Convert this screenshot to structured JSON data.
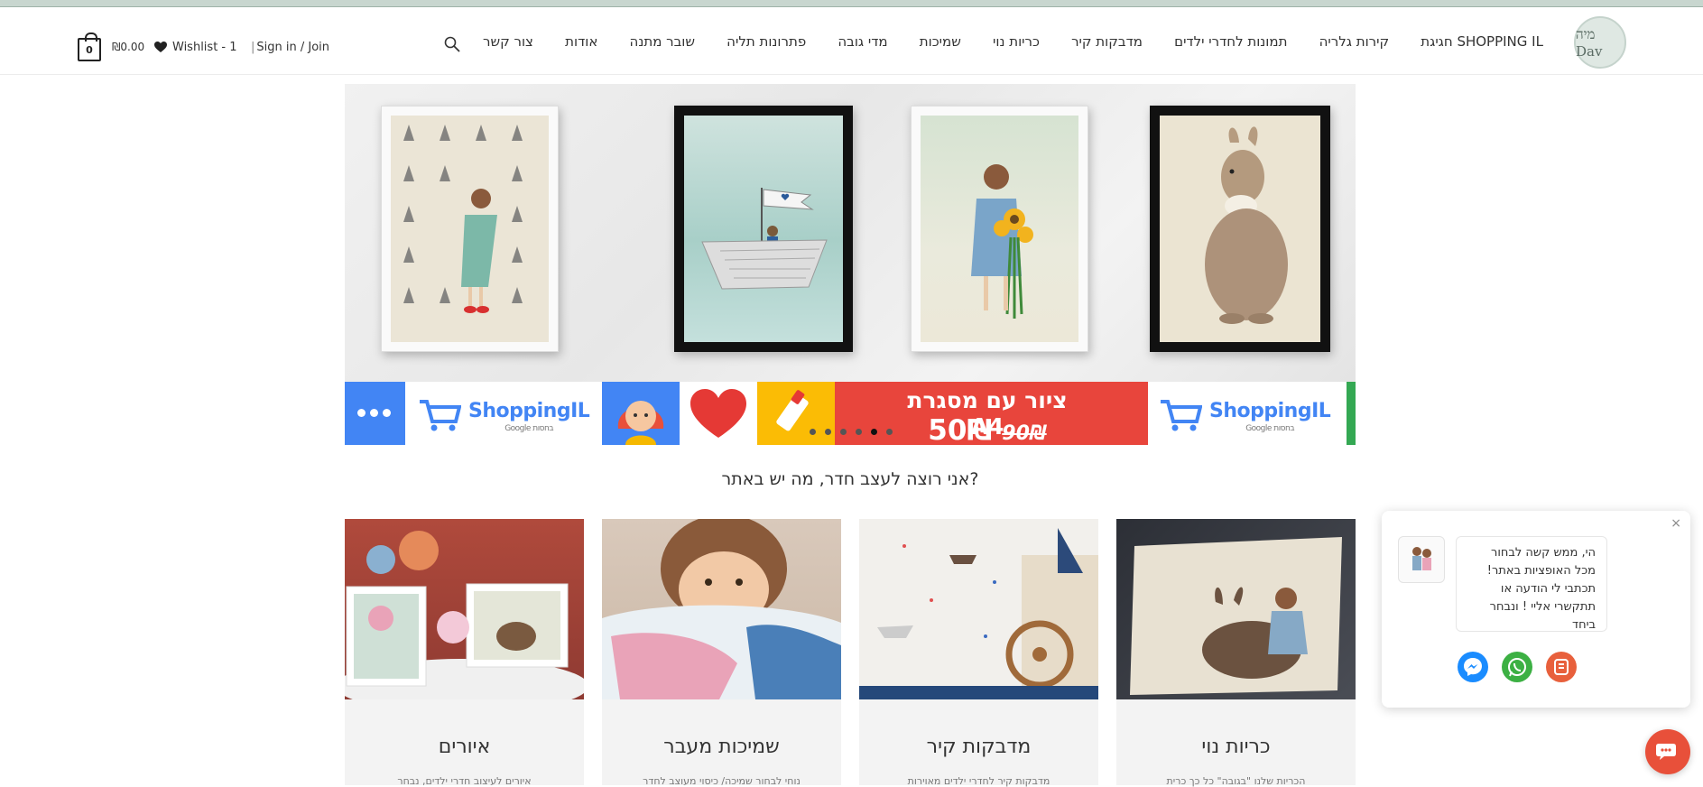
{
  "header": {
    "logo_text": "מיה Dav",
    "nav": [
      "חגיגת SHOPPING IL",
      "קירות גלריה",
      "תמונות לחדרי ילדים",
      "מדבקות קיר",
      "כריות נוי",
      "שמיכות",
      "מדי גובה",
      "פתרונות תליה",
      "שובר מתנה",
      "אודות",
      "צור קשר"
    ],
    "account_label": "Sign in / Join",
    "wishlist_label": "Wishlist - 1",
    "cart_total": "₪0.00",
    "cart_count": "0"
  },
  "hero": {
    "promo_title": "ציור עם מסגרת A4",
    "promo_price_new": "50₪",
    "promo_price_old": "90₪",
    "shopping_logo": "ShoppingIL",
    "shopping_logo_sub": "Google בחסות",
    "slides_count": 6,
    "active_slide": 5
  },
  "section": {
    "question": "אני רוצה לעצב חדר, מה יש באתר?"
  },
  "cards": [
    {
      "title": "כריות נוי",
      "desc": "הכריות שלנו \"בגובה\" כל כך כרית"
    },
    {
      "title": "מדבקות קיר",
      "desc": "מדבקות קיר לחדרי ילדים מאוירות"
    },
    {
      "title": "שמיכות מעבר",
      "desc": "נוחי לבחור שמיכה/ כיסוי מעוצב לחדר"
    },
    {
      "title": "איורים",
      "desc": "איורים לעיצוב חדרי ילדים, נבחר"
    }
  ],
  "chat": {
    "message_line1": "הי, ממש קשה לבחור מכל האופציות באתר!",
    "message_line2": "תכתבי לי הודעה או תתקשרי אליי ! ונבחר ביחד",
    "close_symbol": "×"
  },
  "colors": {
    "promo_red": "#e8453c",
    "google_blue": "#4285f4",
    "messenger_blue": "#1a8cff",
    "whatsapp_green": "#3cb043",
    "call_orange": "#e8603c"
  }
}
